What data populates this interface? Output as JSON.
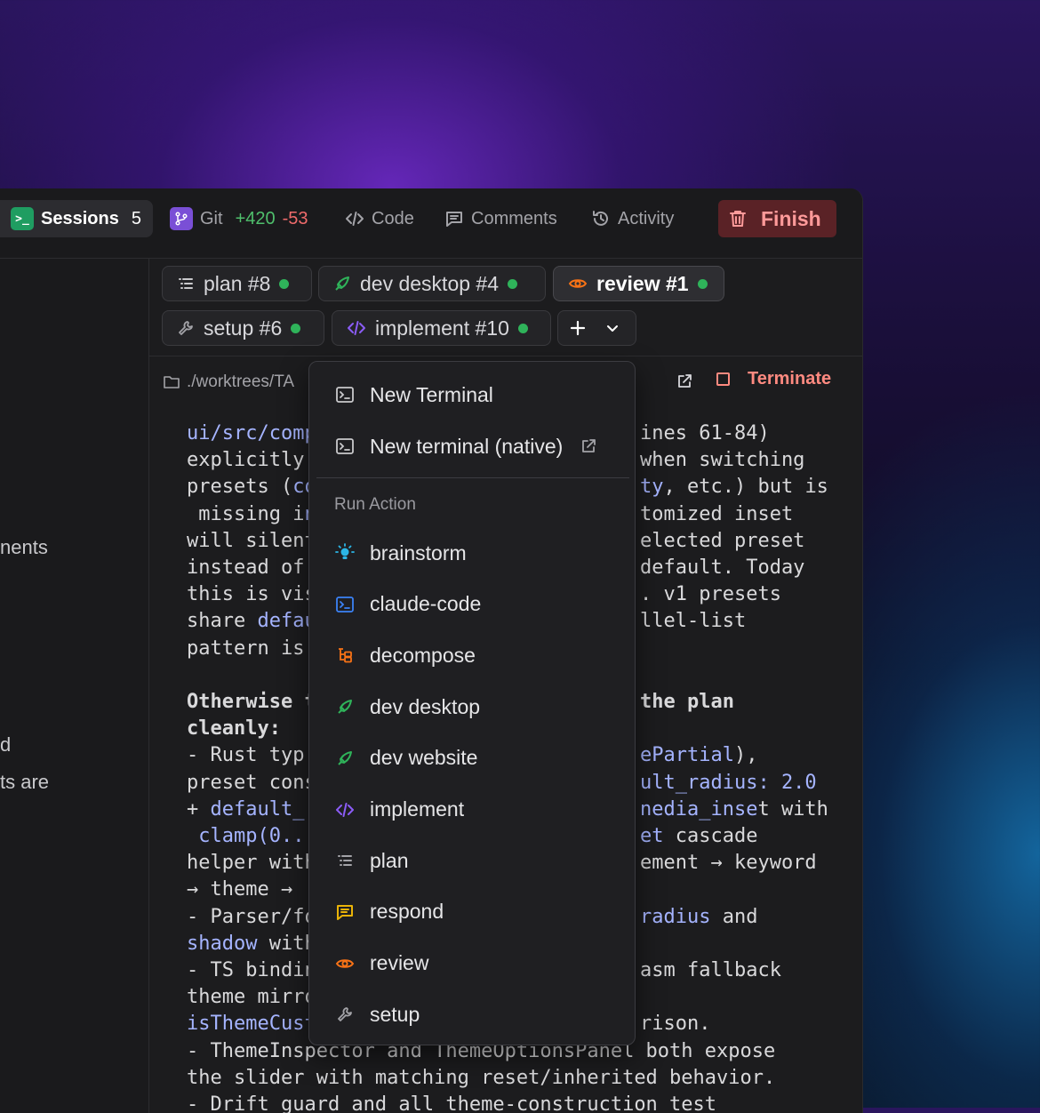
{
  "topbar": {
    "sessions": {
      "label": "Sessions",
      "count": "5"
    },
    "git": {
      "label": "Git",
      "added": "+420",
      "removed": "-53"
    },
    "code": "Code",
    "comments": "Comments",
    "activity": "Activity",
    "finish": "Finish"
  },
  "sidebar": {
    "frag1": "nents",
    "frag2": "d",
    "frag3": "ts are"
  },
  "tabs": [
    {
      "label": "plan #8",
      "icon": "list-icon"
    },
    {
      "label": "dev desktop #4",
      "icon": "rocket-icon"
    },
    {
      "label": "review #1",
      "icon": "eye-icon",
      "active": true
    },
    {
      "label": "setup #6",
      "icon": "wrench-icon"
    },
    {
      "label": "implement #10",
      "icon": "code-icon"
    }
  ],
  "pathbar": {
    "path": "./worktrees/TA",
    "terminate": "Terminate"
  },
  "terminal": {
    "lines": [
      "ui/src/comp",
      "explicitly ",
      "presets (co",
      " missing in",
      "will silent",
      "instead of ",
      "this is vis",
      "share defau",
      "pattern is ",
      "",
      "Otherwise t",
      "cleanly:",
      "- Rust typ",
      "preset cons",
      "+ default_",
      " clamp(0..",
      "helper with",
      "→ theme → (",
      "- Parser/fo",
      "shadow with",
      "- TS bindin",
      "theme mirro",
      "isThemeCust",
      "- ThemeInspector and ThemeOptionsPanel both expose",
      "the slider with matching reset/inherited behavior.",
      "- Drift guard and all theme-construction test"
    ],
    "right": [
      "ines 61-84)",
      "when switching",
      "ty, etc.) but is",
      "tomized inset",
      "elected preset",
      "default. Today",
      ". v1 presets",
      "llel-list",
      "",
      "",
      "the plan",
      "",
      "ePartial),",
      "ult_radius: 2.0",
      "nedia_inset with",
      "et cascade",
      "ement → keyword",
      "",
      "radius and",
      "",
      "asm fallback",
      "",
      "rison."
    ]
  },
  "dropdown": {
    "new_terminal": "New Terminal",
    "new_terminal_native": "New terminal (native)",
    "section": "Run Action",
    "actions": [
      {
        "label": "brainstorm",
        "icon": "lightbulb-icon",
        "color": "#2bb6e6"
      },
      {
        "label": "claude-code",
        "icon": "terminal-icon",
        "color": "#3b82f6"
      },
      {
        "label": "decompose",
        "icon": "tree-icon",
        "color": "#f97316"
      },
      {
        "label": "dev desktop",
        "icon": "rocket-icon",
        "color": "#2fb35a"
      },
      {
        "label": "dev website",
        "icon": "rocket-icon",
        "color": "#2fb35a"
      },
      {
        "label": "implement",
        "icon": "code-icon",
        "color": "#8b5cf6"
      },
      {
        "label": "plan",
        "icon": "list-icon",
        "color": "#a3a3a8"
      },
      {
        "label": "respond",
        "icon": "message-icon",
        "color": "#eab308"
      },
      {
        "label": "review",
        "icon": "eye-icon",
        "color": "#f97316"
      },
      {
        "label": "setup",
        "icon": "wrench-icon",
        "color": "#a3a3a8"
      }
    ]
  }
}
